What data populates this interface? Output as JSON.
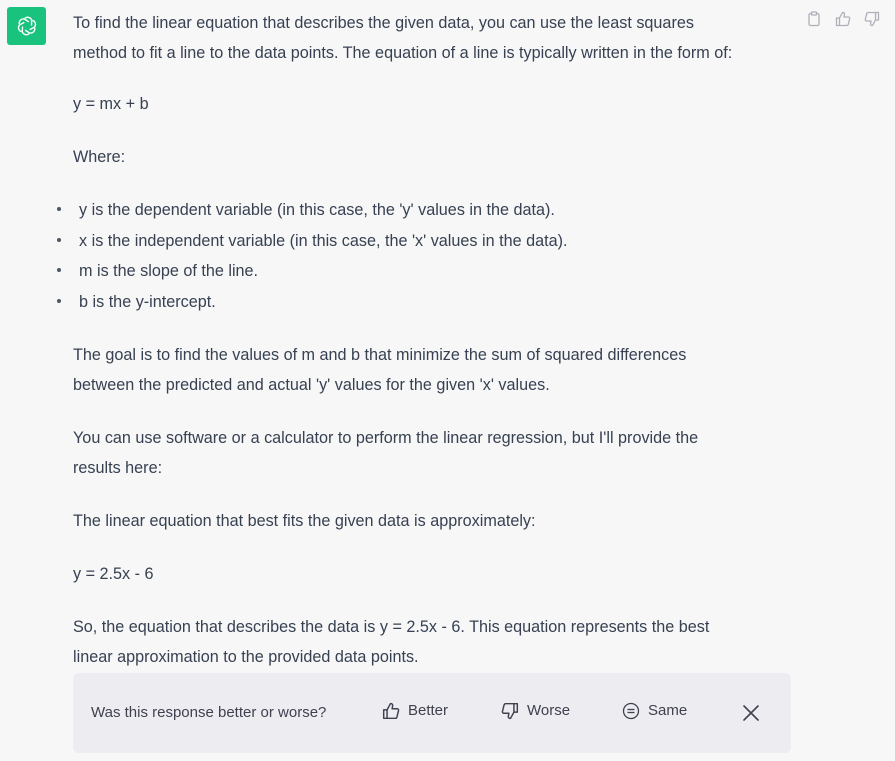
{
  "message": {
    "p1a": "To find the linear equation that describes the given data, you can use the least squares",
    "p1b": "method to fit a line to the data points. The equation of a line is typically written in the form of:",
    "eq_general": "y = mx + b",
    "where": "Where:",
    "bullets": [
      "y is the dependent variable (in this case, the 'y' values in the data).",
      "x is the independent variable (in this case, the 'x' values in the data).",
      "m is the slope of the line.",
      "b is the y-intercept."
    ],
    "goal_a": "The goal is to find the values of m and b that minimize the sum of squared differences",
    "goal_b": "between the predicted and actual 'y' values for the given 'x' values.",
    "software_a": "You can use software or a calculator to perform the linear regression, but I'll provide the",
    "software_b": "results here:",
    "best_fit": "The linear equation that best fits the given data is approximately:",
    "eq_result": "y = 2.5x - 6",
    "conclusion_a": "So, the equation that describes the data is y = 2.5x - 6. This equation represents the best",
    "conclusion_b": "linear approximation to the provided data points."
  },
  "feedback": {
    "question": "Was this response better or worse?",
    "better": "Better",
    "worse": "Worse",
    "same": "Same"
  },
  "icons": {
    "avatar": "openai-logo-icon",
    "copy": "clipboard-icon",
    "like": "thumbs-up-icon",
    "dislike": "thumbs-down-icon",
    "close": "close-icon"
  },
  "colors": {
    "avatar_bg": "#19c37d",
    "page_bg": "#f7f7f8",
    "feedback_bg": "#ececf1",
    "text": "#374151"
  }
}
